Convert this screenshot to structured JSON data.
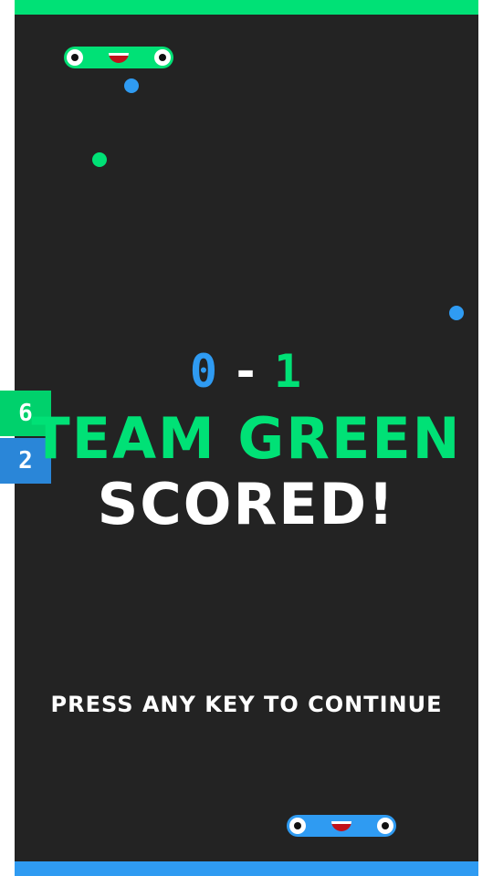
{
  "colors": {
    "green": "#00e176",
    "blue": "#2f9bf2",
    "arena": "#232323",
    "wall_side": "#ffffff"
  },
  "score": {
    "blue": "0",
    "separator": "-",
    "green": "1"
  },
  "team_counters": {
    "green": "6",
    "blue": "2"
  },
  "message": {
    "line1": "TEAM GREEN",
    "line2": "SCORED!"
  },
  "prompt": "PRESS ANY KEY TO CONTINUE"
}
